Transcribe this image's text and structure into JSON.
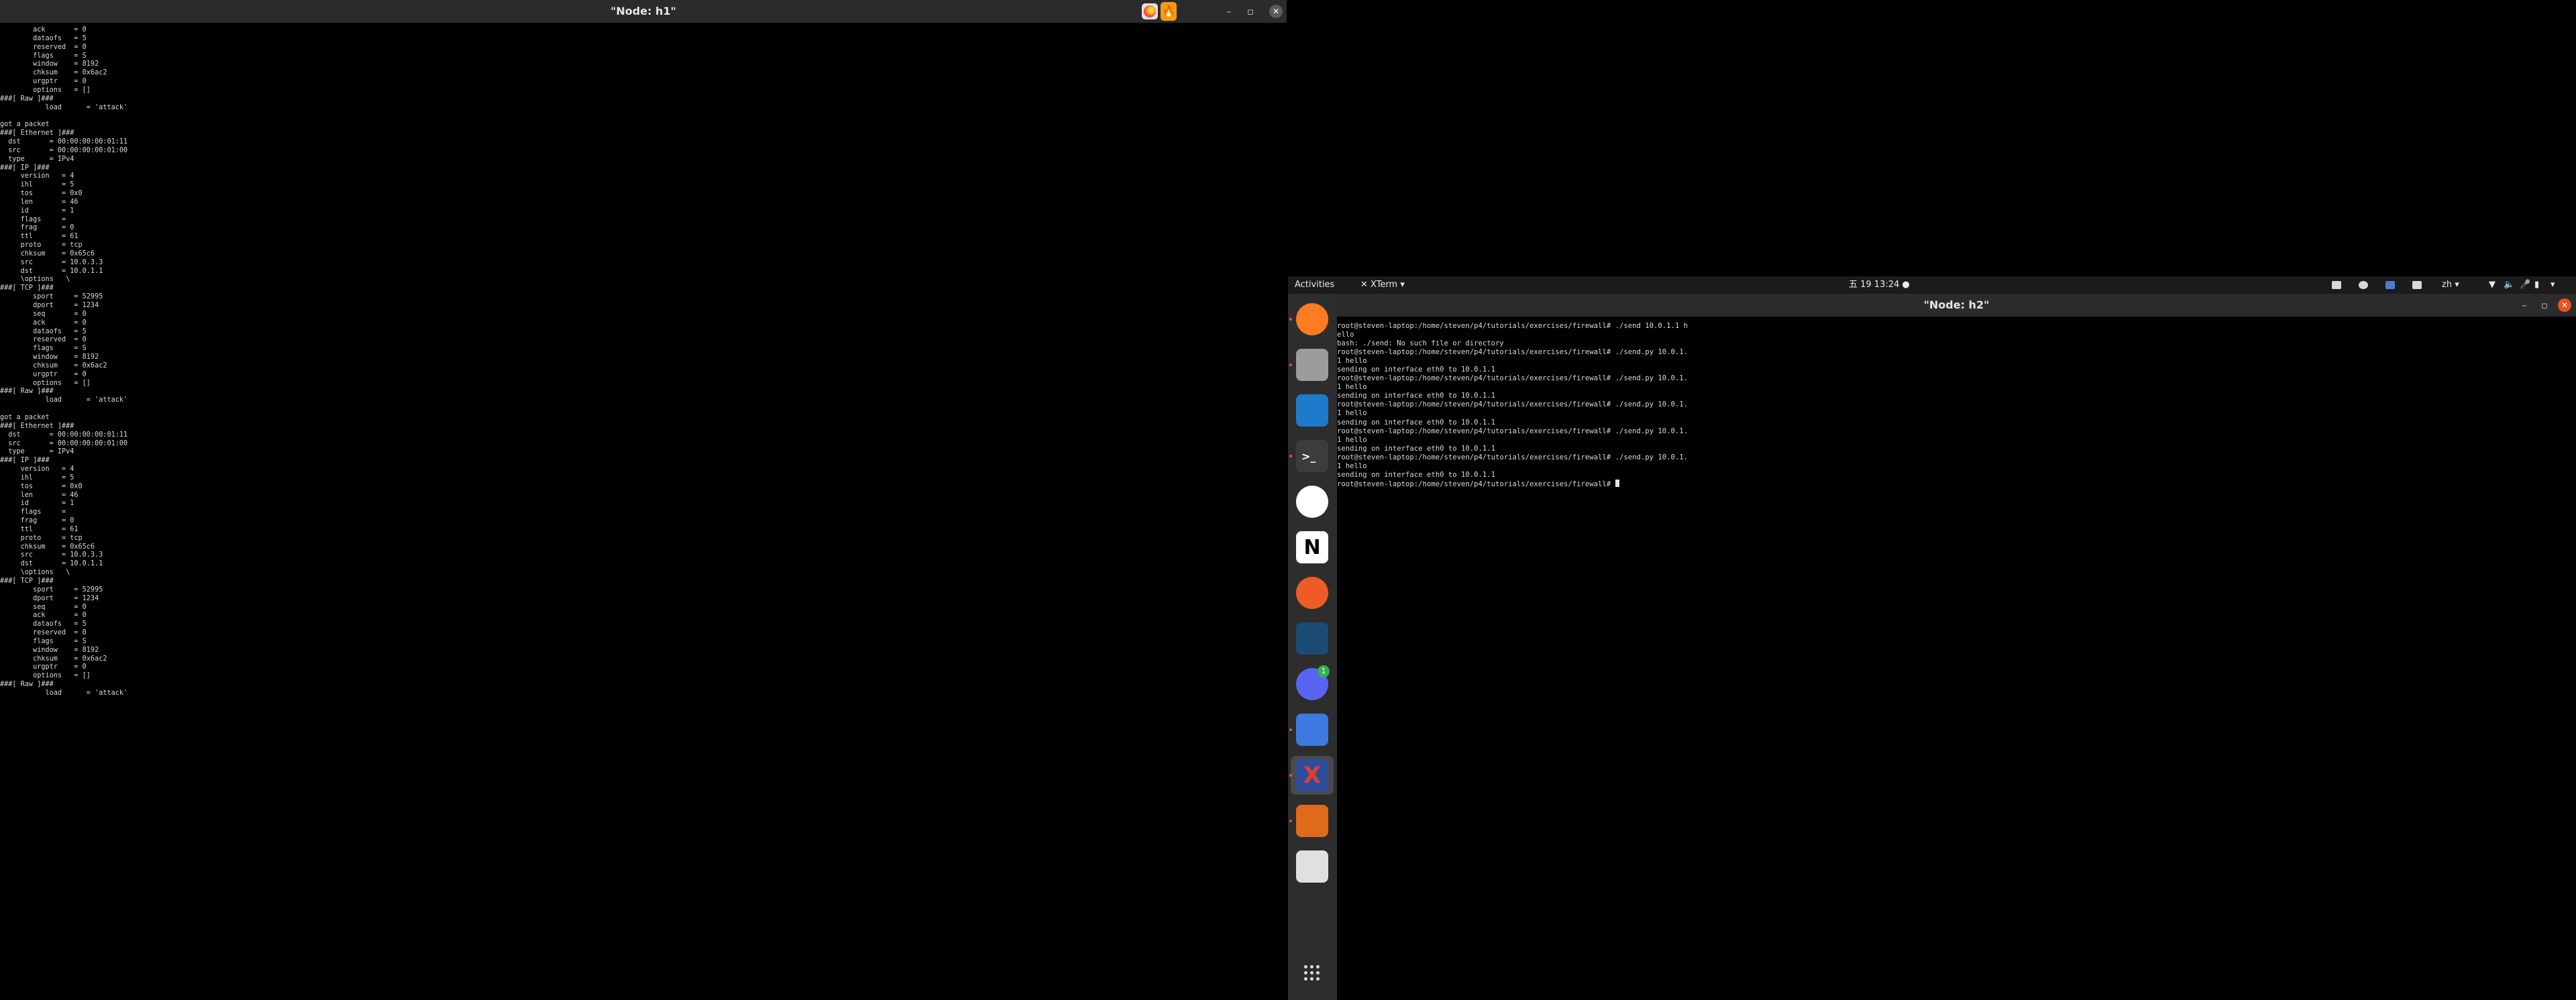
{
  "window_left": {
    "title": "\"Node: h1\"",
    "controls": {
      "minimize": "–",
      "maximize": "▫",
      "close": "✕"
    },
    "lines": [
      "        ack       = 0",
      "        dataofs   = 5",
      "        reserved  = 0",
      "        flags     = S",
      "        window    = 8192",
      "        chksum    = 0x6ac2",
      "        urgptr    = 0",
      "        options   = []",
      "###[ Raw ]###",
      "           load      = 'attack'",
      "",
      "got a packet",
      "###[ Ethernet ]###",
      "  dst       = 00:00:00:00:01:11",
      "  src       = 00:00:00:00:01:00",
      "  type      = IPv4",
      "###[ IP ]###",
      "     version   = 4",
      "     ihl       = 5",
      "     tos       = 0x0",
      "     len       = 46",
      "     id        = 1",
      "     flags     =",
      "     frag      = 0",
      "     ttl       = 61",
      "     proto     = tcp",
      "     chksum    = 0x65c6",
      "     src       = 10.0.3.3",
      "     dst       = 10.0.1.1",
      "     \\options   \\",
      "###[ TCP ]###",
      "        sport     = 52995",
      "        dport     = 1234",
      "        seq       = 0",
      "        ack       = 0",
      "        dataofs   = 5",
      "        reserved  = 0",
      "        flags     = S",
      "        window    = 8192",
      "        chksum    = 0x6ac2",
      "        urgptr    = 0",
      "        options   = []",
      "###[ Raw ]###",
      "           load      = 'attack'",
      "",
      "got a packet",
      "###[ Ethernet ]###",
      "  dst       = 00:00:00:00:01:11",
      "  src       = 00:00:00:00:01:00",
      "  type      = IPv4",
      "###[ IP ]###",
      "     version   = 4",
      "     ihl       = 5",
      "     tos       = 0x0",
      "     len       = 46",
      "     id        = 1",
      "     flags     =",
      "     frag      = 0",
      "     ttl       = 61",
      "     proto     = tcp",
      "     chksum    = 0x65c6",
      "     src       = 10.0.3.3",
      "     dst       = 10.0.1.1",
      "     \\options   \\",
      "###[ TCP ]###",
      "        sport     = 52995",
      "        dport     = 1234",
      "        seq       = 0",
      "        ack       = 0",
      "        dataofs   = 5",
      "        reserved  = 0",
      "        flags     = S",
      "        window    = 8192",
      "        chksum    = 0x6ac2",
      "        urgptr    = 0",
      "        options   = []",
      "###[ Raw ]###",
      "           load      = 'attack'"
    ]
  },
  "topbar": {
    "activities": "Activities",
    "app_menu": "XTerm ▾",
    "clock": "五 19  13:24",
    "language": "zh ▾"
  },
  "dock": {
    "items": [
      {
        "name": "firefox-icon",
        "color": "#ff7b22"
      },
      {
        "name": "files-icon",
        "color": "#9c9c9c"
      },
      {
        "name": "vscode-icon",
        "color": "#1f7acb"
      },
      {
        "name": "terminal-icon",
        "color": "#3c3c3c"
      },
      {
        "name": "slack-icon",
        "color": "#ffffff"
      },
      {
        "name": "notion-icon",
        "color": "#ffffff"
      },
      {
        "name": "postman-icon",
        "color": "#ef5b25"
      },
      {
        "name": "mysql-workbench-icon",
        "color": "#1b4a75"
      },
      {
        "name": "discord-icon",
        "color": "#5865f2",
        "badge": "1"
      },
      {
        "name": "text-editor-icon",
        "color": "#3d7ae0"
      },
      {
        "name": "xterm-icon",
        "color": "#2d4d9b"
      },
      {
        "name": "document-viewer-icon",
        "color": "#e06a1b"
      },
      {
        "name": "image-viewer-icon",
        "color": "#e0e0e0"
      }
    ]
  },
  "window_right": {
    "title": "\"Node: h2\"",
    "controls": {
      "minimize": "–",
      "maximize": "▫",
      "close": "✕"
    },
    "lines": [
      "root@steven-laptop:/home/steven/p4/tutorials/exercises/firewall# ./send 10.0.1.1 h",
      "ello",
      "bash: ./send: No such file or directory",
      "root@steven-laptop:/home/steven/p4/tutorials/exercises/firewall# ./send.py 10.0.1.",
      "1 hello",
      "sending on interface eth0 to 10.0.1.1",
      "root@steven-laptop:/home/steven/p4/tutorials/exercises/firewall# ./send.py 10.0.1.",
      "1 hello",
      "sending on interface eth0 to 10.0.1.1",
      "root@steven-laptop:/home/steven/p4/tutorials/exercises/firewall# ./send.py 10.0.1.",
      "1 hello",
      "sending on interface eth0 to 10.0.1.1",
      "root@steven-laptop:/home/steven/p4/tutorials/exercises/firewall# ./send.py 10.0.1.",
      "1 hello",
      "sending on interface eth0 to 10.0.1.1",
      "root@steven-laptop:/home/steven/p4/tutorials/exercises/firewall# ./send.py 10.0.1.",
      "1 hello",
      "sending on interface eth0 to 10.0.1.1"
    ],
    "prompt": "root@steven-laptop:/home/steven/p4/tutorials/exercises/firewall# "
  }
}
